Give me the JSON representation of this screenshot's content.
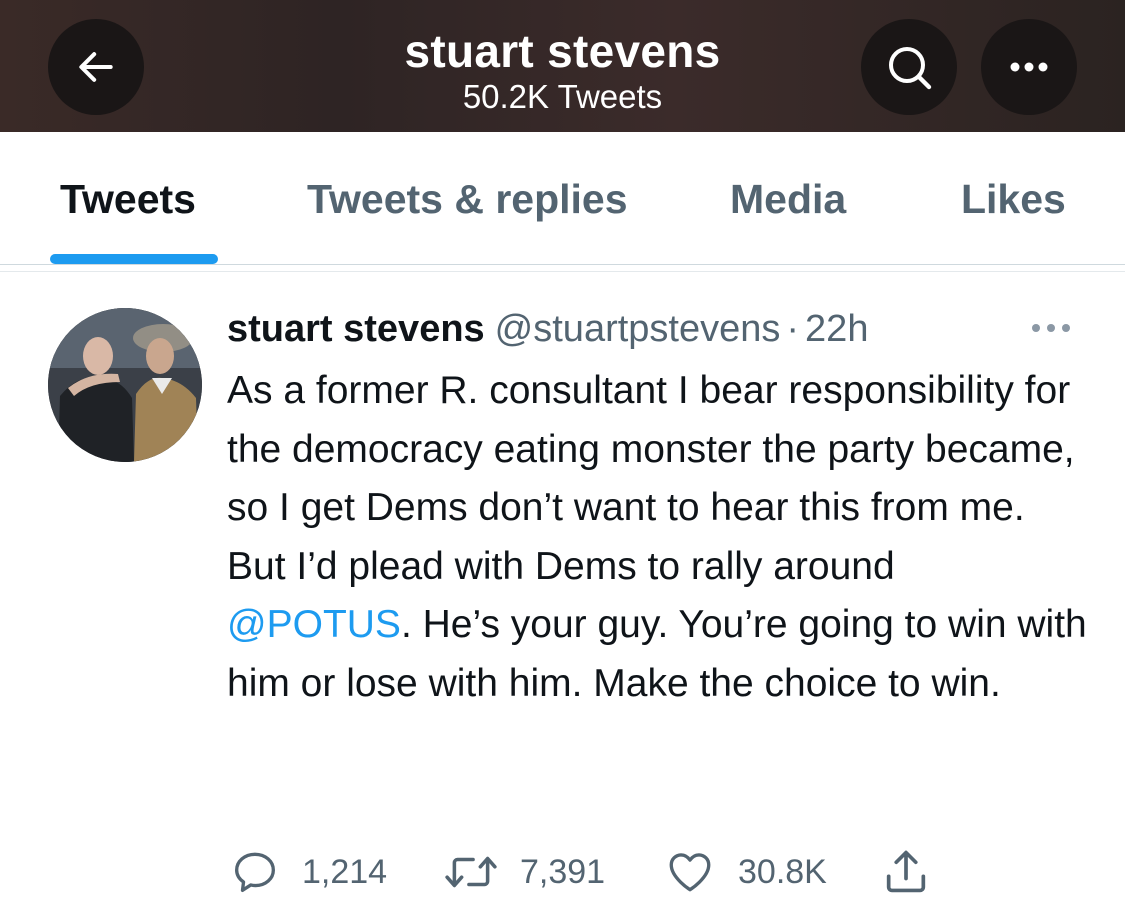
{
  "header": {
    "title": "stuart stevens",
    "subtitle": "50.2K Tweets",
    "back_icon": "arrow-left-icon",
    "search_icon": "search-icon",
    "more_icon": "more-horizontal-icon"
  },
  "tabs": [
    {
      "label": "Tweets",
      "active": true
    },
    {
      "label": "Tweets & replies",
      "active": false
    },
    {
      "label": "Media",
      "active": false
    },
    {
      "label": "Likes",
      "active": false
    }
  ],
  "tweet": {
    "author_name": "stuart stevens",
    "author_handle": "@stuartpstevens",
    "separator": "·",
    "time": "22h",
    "text_before_mention": "As a former R. consultant I bear responsibility for the democracy eating monster the party became, so I get Dems don’t want to hear this from me. But I’d plead with Dems to rally around ",
    "mention": "@POTUS",
    "text_after_mention": ". He’s your guy. You’re going to win with him or lose with him. Make the choice to win.",
    "replies": "1,214",
    "retweets": "7,391",
    "likes": "30.8K"
  },
  "colors": {
    "accent": "#1d9bf0",
    "secondary_text": "#536471",
    "primary_text": "#0f1419"
  }
}
